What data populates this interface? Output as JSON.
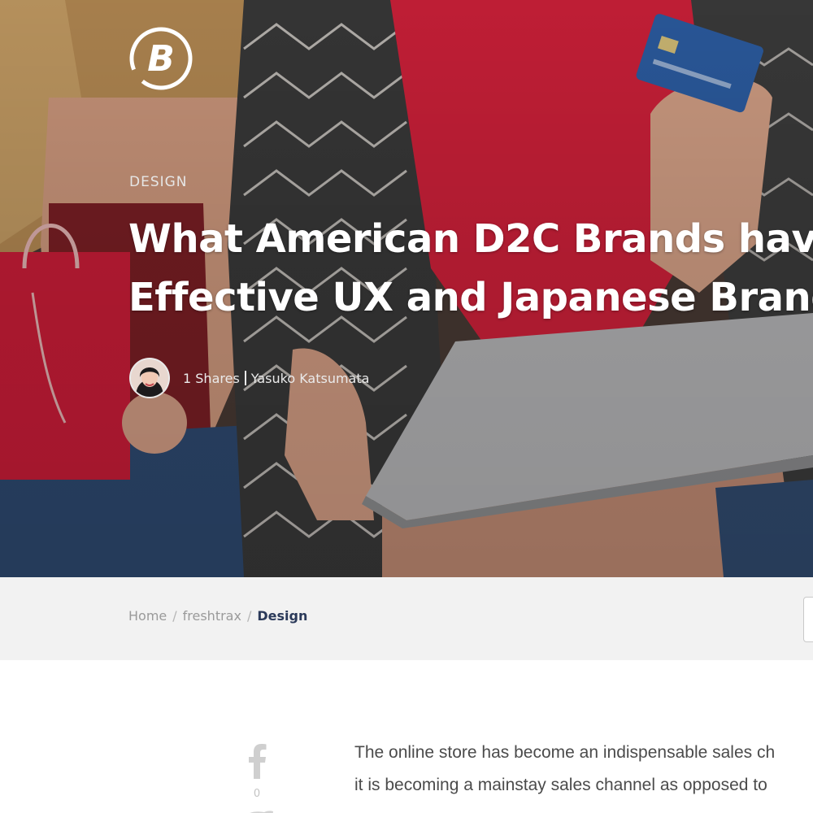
{
  "hero": {
    "category": "DESIGN",
    "title_line1": "What American D2C Brands have",
    "title_line2": "Effective UX and Japanese Brand",
    "shares": "1 Shares",
    "author": "Yasuko Katsumata"
  },
  "logo": {
    "icon": "brand-b-logo",
    "color": "#ffffff"
  },
  "breadcrumb": {
    "items": [
      "Home",
      "freshtrax"
    ],
    "current": "Design",
    "separator": "/"
  },
  "share": {
    "facebook_icon": "facebook-icon",
    "facebook_count": "0",
    "twitter_icon": "twitter-icon"
  },
  "article": {
    "line1": "The online store has become an indispensable sales ch",
    "line2": "it is becoming a mainstay sales channel as opposed to"
  },
  "colors": {
    "breadcrumb_current": "#2b3a5a",
    "bar_bg": "#f2f2f2",
    "body_text": "#4b4b4b"
  }
}
